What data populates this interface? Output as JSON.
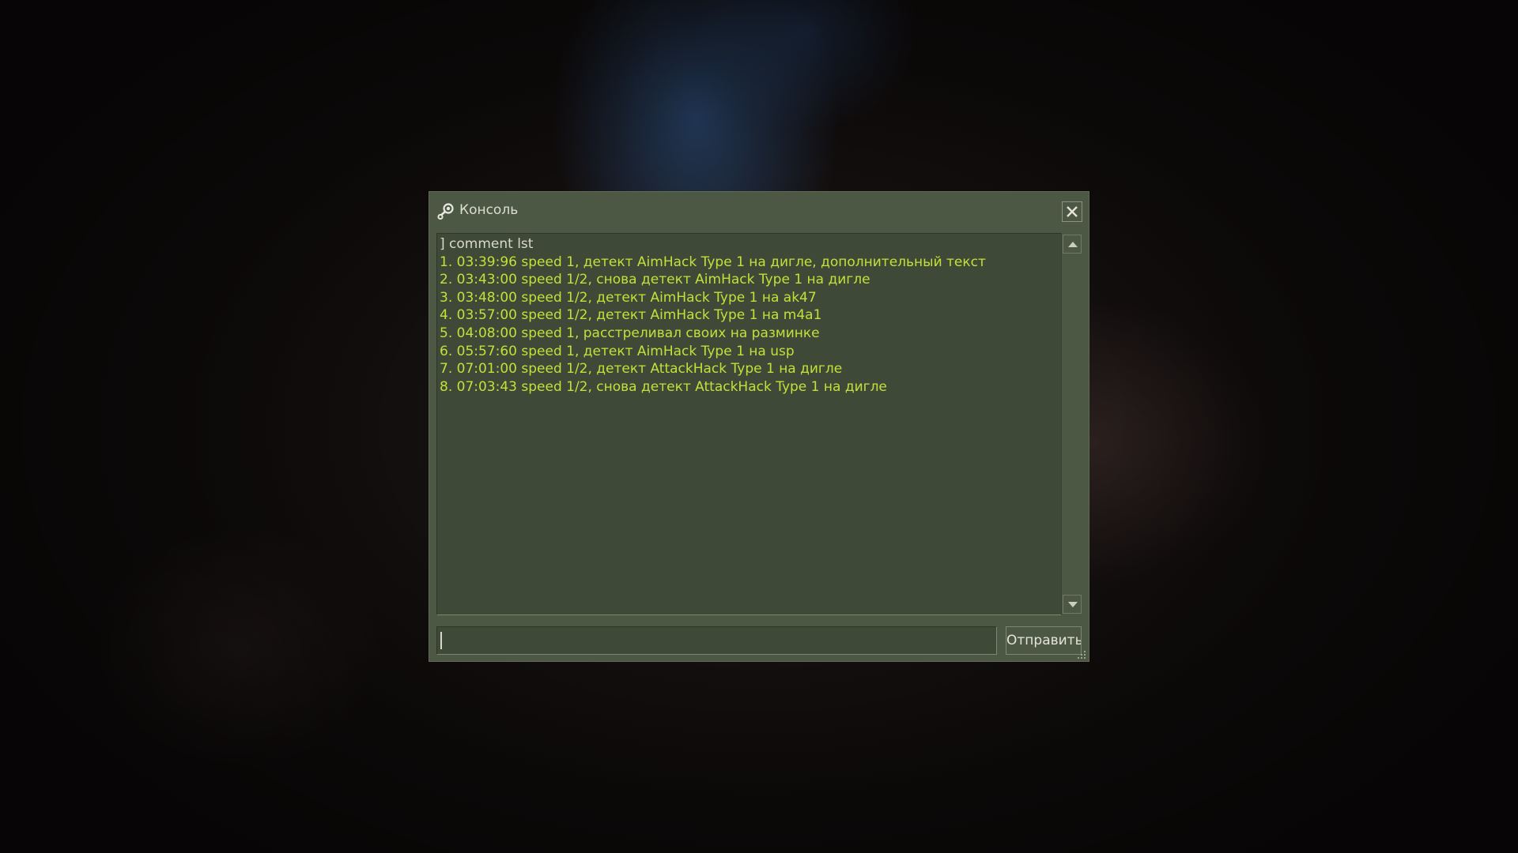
{
  "window": {
    "title": "Консоль",
    "icon": "steam-logo-icon",
    "close_icon": "close-icon"
  },
  "console": {
    "command": "] comment lst",
    "lines": [
      "1. 03:39:96 speed 1, детект AimHack Type 1 на дигле, дополнительный текст",
      "2. 03:43:00 speed 1/2, снова детект AimHack Type 1 на дигле",
      "3. 03:48:00 speed 1/2, детект AimHack Type 1 на ak47",
      "4. 03:57:00 speed 1/2, детект AimHack Type 1 на m4a1",
      "5. 04:08:00 speed 1, расстреливал своих на разминке",
      "6. 05:57:60 speed 1, детект AimHack Type 1 на usp",
      "7. 07:01:00 speed 1/2, детект AttackHack Type 1 на дигле",
      "8. 07:03:43 speed 1/2, снова детект AttackHack Type 1 на дигле"
    ]
  },
  "input": {
    "value": "",
    "placeholder": ""
  },
  "submit": {
    "label": "Отправить"
  },
  "colors": {
    "panel": "#4c5844",
    "text_area": "#3e4a37",
    "output_text": "#c2e03a",
    "command_text": "#d8d8ce"
  }
}
